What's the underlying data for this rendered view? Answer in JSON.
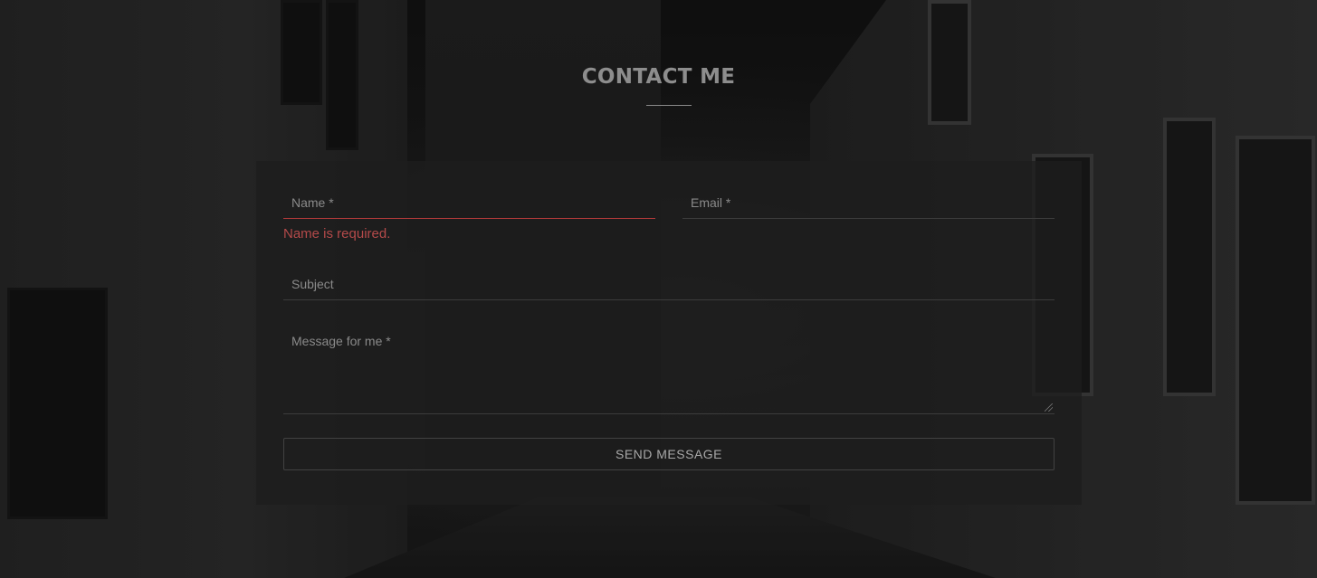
{
  "page": {
    "title": "CONTACT ME"
  },
  "form": {
    "name": {
      "label": "Name *",
      "value": ""
    },
    "email": {
      "label": "Email *",
      "value": ""
    },
    "subject": {
      "label": "Subject",
      "value": ""
    },
    "message": {
      "label": "Message for me *",
      "value": ""
    },
    "errors": {
      "name": "Name is required."
    },
    "submit_label": "SEND MESSAGE"
  },
  "colors": {
    "title": "#8d8d8d",
    "error": "#b44a4a",
    "error_underline": "#b23a3a",
    "panel": "#1e1e1e"
  }
}
